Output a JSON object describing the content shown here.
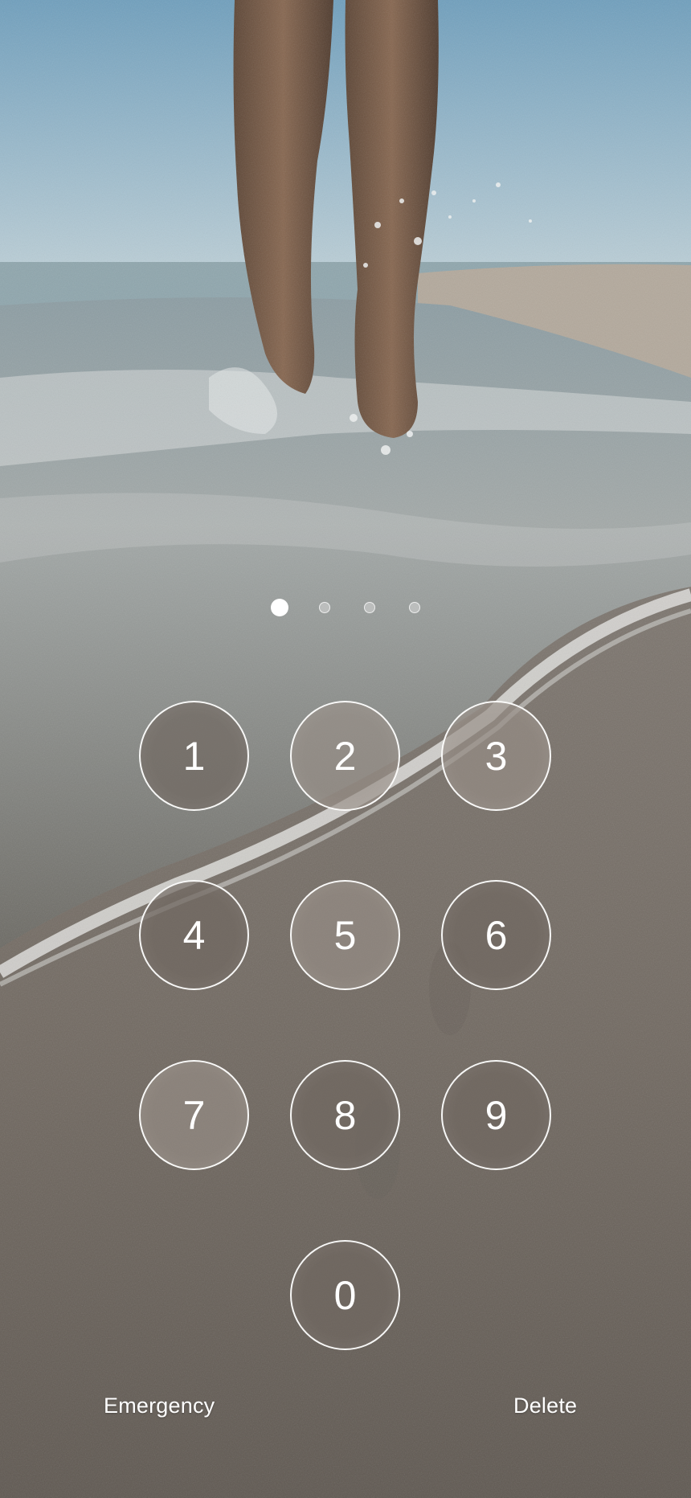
{
  "passcode": {
    "entered_count": 1,
    "total_digits": 4
  },
  "keypad": {
    "keys": [
      "1",
      "2",
      "3",
      "4",
      "5",
      "6",
      "7",
      "8",
      "9",
      "0"
    ]
  },
  "actions": {
    "emergency_label": "Emergency",
    "delete_label": "Delete"
  },
  "colors": {
    "key_border": "#ffffff",
    "key_fill": "#706861",
    "text": "#ffffff"
  }
}
